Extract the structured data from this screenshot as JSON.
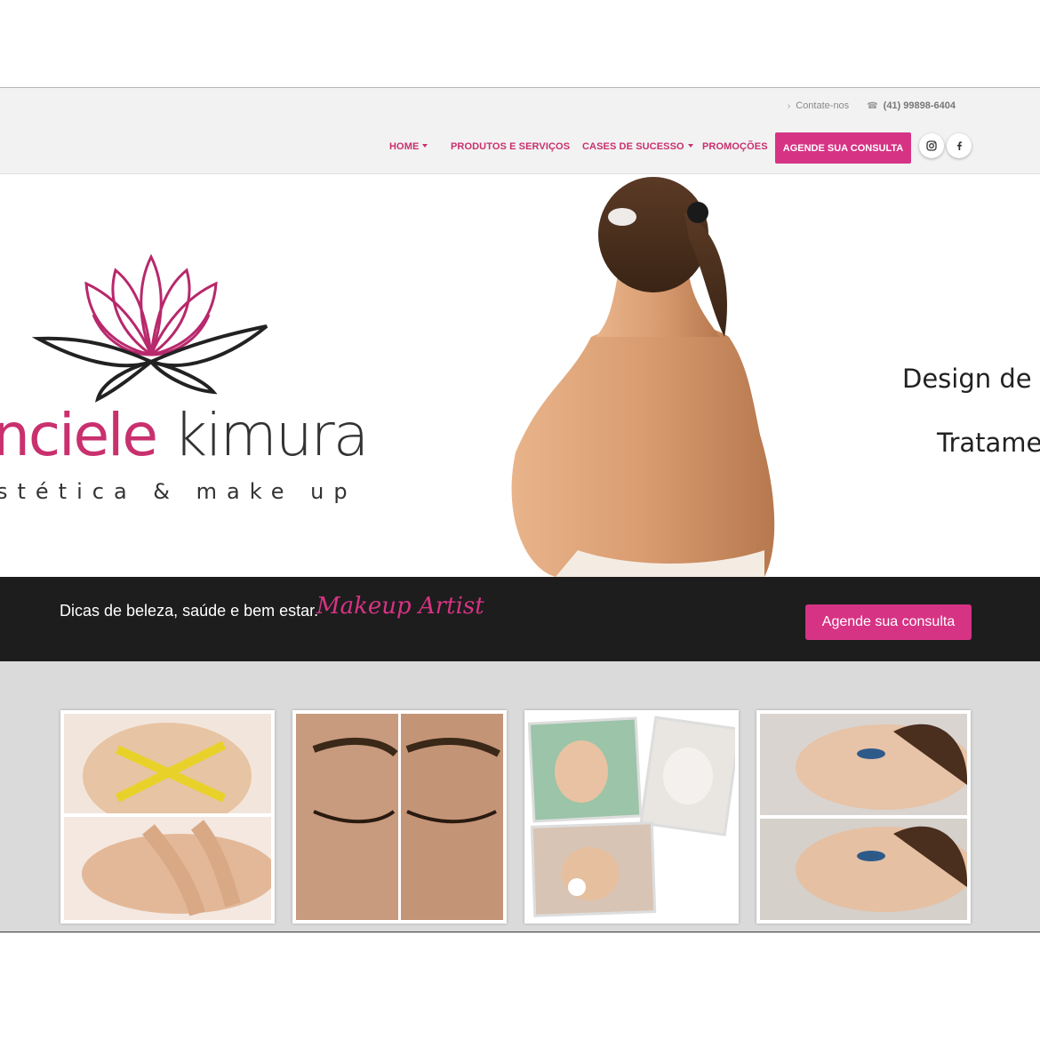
{
  "topbar": {
    "contact_label": "Contate-nos",
    "phone": "(41) 99898-6404"
  },
  "nav": {
    "items": [
      {
        "label": "HOME"
      },
      {
        "label": "PRODUTOS E SERVIÇOS"
      },
      {
        "label": "CASES DE SUCESSO"
      },
      {
        "label": "PROMOÇÕES"
      }
    ],
    "cta": "AGENDE SUA CONSULTA",
    "social": [
      {
        "icon": "instagram-icon"
      },
      {
        "icon": "facebook-icon"
      }
    ]
  },
  "hero": {
    "logo_name_pink": "nciele",
    "logo_name_dark": "kimura",
    "logo_sub": "stética & make up",
    "line1": "Design de S",
    "line2": "Tratame"
  },
  "band": {
    "text": "Dicas de beleza, saúde e bem estar.",
    "script": "Makeup Artist",
    "button": "Agende sua consulta"
  },
  "colors": {
    "accent": "#d63384",
    "nav_text": "#c9306e",
    "band_bg": "#1d1d1d",
    "gallery_bg": "#dadada"
  }
}
